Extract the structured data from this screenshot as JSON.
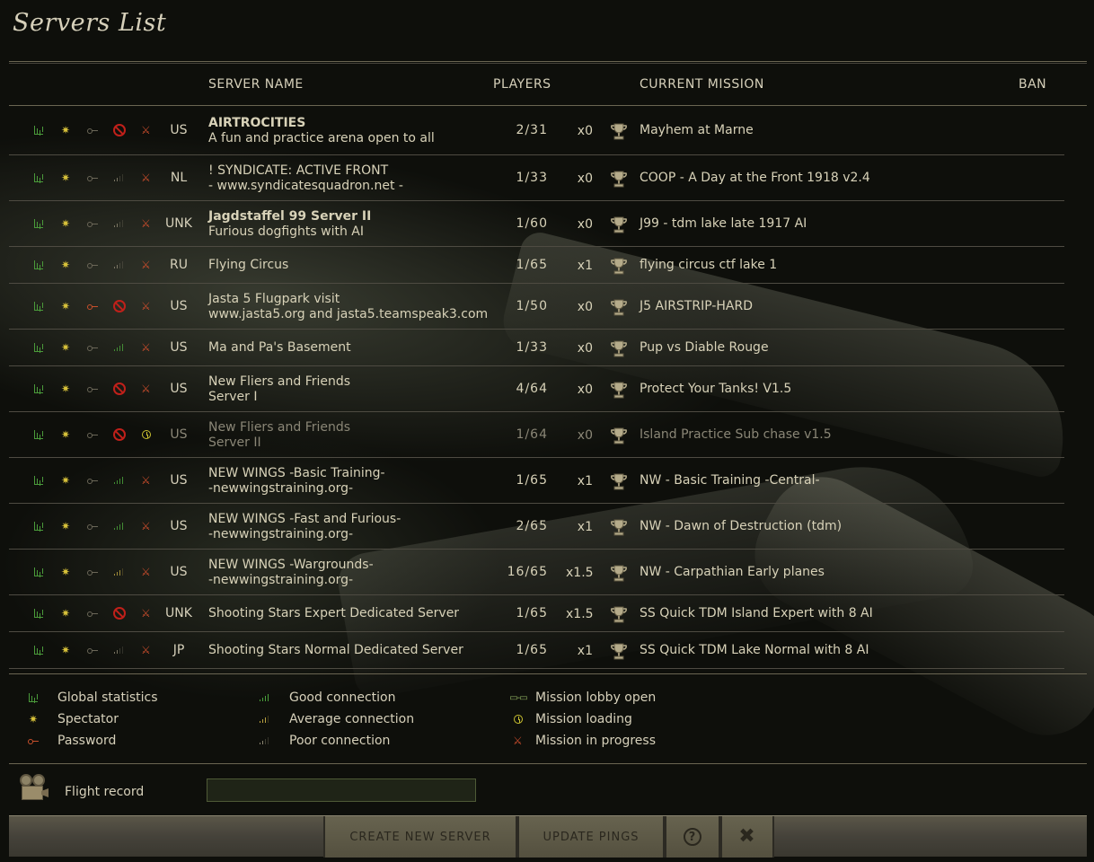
{
  "title": "Servers List",
  "columns": {
    "server_name": "SERVER NAME",
    "players": "PLAYERS",
    "current_mission": "CURRENT MISSION",
    "ban": "BAN"
  },
  "servers": [
    {
      "country": "US",
      "name_l1": "AIRTROCITIES",
      "name_l2": "A fun and practice arena open to all",
      "bold": true,
      "players": "2/31",
      "mult": "x0",
      "mission": "Mayhem at Marne",
      "password": false,
      "banned": true,
      "signal": "none",
      "status": "in-progress",
      "dim": false
    },
    {
      "country": "NL",
      "name_l1": "!        SYNDICATE: ACTIVE FRONT",
      "name_l2": "-   www.syndicatesquadron.net   -",
      "bold": false,
      "players": "1/33",
      "mult": "x0",
      "mission": "COOP - A Day at the Front 1918 v2.4",
      "password": false,
      "banned": false,
      "signal": "poor",
      "status": "in-progress",
      "dim": false
    },
    {
      "country": "UNK",
      "name_l1": "Jagdstaffel 99 Server II",
      "name_l2": "Furious dogfights with AI",
      "bold": true,
      "players": "1/60",
      "mult": "x0",
      "mission": "J99 - tdm lake late 1917 AI",
      "password": false,
      "banned": false,
      "signal": "poor",
      "status": "in-progress",
      "dim": false
    },
    {
      "country": "RU",
      "name_l1": "Flying Circus",
      "name_l2": "",
      "bold": false,
      "players": "1/65",
      "mult": "x1",
      "mission": "flying circus ctf lake 1",
      "password": false,
      "banned": false,
      "signal": "poor",
      "status": "in-progress",
      "dim": false
    },
    {
      "country": "US",
      "name_l1": "Jasta 5 Flugpark                 visit",
      "name_l2": "www.jasta5.org and jasta5.teamspeak3.com",
      "bold": false,
      "players": "1/50",
      "mult": "x0",
      "mission": "J5 AIRSTRIP-HARD",
      "password": true,
      "banned": true,
      "signal": "none",
      "status": "in-progress",
      "dim": false
    },
    {
      "country": "US",
      "name_l1": "Ma and Pa's Basement",
      "name_l2": "",
      "bold": false,
      "players": "1/33",
      "mult": "x0",
      "mission": "Pup vs Diable Rouge",
      "password": false,
      "banned": false,
      "signal": "good",
      "status": "in-progress",
      "dim": false
    },
    {
      "country": "US",
      "name_l1": "New Fliers and Friends",
      "name_l2": "Server I",
      "bold": false,
      "players": "4/64",
      "mult": "x0",
      "mission": "Protect Your Tanks! V1.5",
      "password": false,
      "banned": true,
      "signal": "none",
      "status": "in-progress",
      "dim": false
    },
    {
      "country": "US",
      "name_l1": "New Fliers and Friends",
      "name_l2": "Server II",
      "bold": false,
      "players": "1/64",
      "mult": "x0",
      "mission": "Island Practice Sub chase v1.5",
      "password": false,
      "banned": true,
      "signal": "none",
      "status": "loading",
      "dim": true
    },
    {
      "country": "US",
      "name_l1": "NEW WINGS -Basic Training-",
      "name_l2": "-newwingstraining.org-",
      "bold": false,
      "players": "1/65",
      "mult": "x1",
      "mission": "NW - Basic Training -Central-",
      "password": false,
      "banned": false,
      "signal": "good",
      "status": "in-progress",
      "dim": false
    },
    {
      "country": "US",
      "name_l1": "NEW WINGS -Fast and Furious-",
      "name_l2": "-newwingstraining.org-",
      "bold": false,
      "players": "2/65",
      "mult": "x1",
      "mission": "NW - Dawn of Destruction (tdm)",
      "password": false,
      "banned": false,
      "signal": "good",
      "status": "in-progress",
      "dim": false
    },
    {
      "country": "US",
      "name_l1": "NEW WINGS -Wargrounds-",
      "name_l2": "-newwingstraining.org-",
      "bold": false,
      "players": "16/65",
      "mult": "x1.5",
      "mission": "NW - Carpathian Early planes",
      "password": false,
      "banned": false,
      "signal": "average",
      "status": "in-progress",
      "dim": false
    },
    {
      "country": "UNK",
      "name_l1": "Shooting Stars Expert Dedicated Server",
      "name_l2": "",
      "bold": false,
      "players": "1/65",
      "mult": "x1.5",
      "mission": "SS Quick TDM Island Expert with 8 AI",
      "password": false,
      "banned": true,
      "signal": "none",
      "status": "in-progress",
      "dim": false
    },
    {
      "country": "JP",
      "name_l1": "Shooting Stars Normal Dedicated Server",
      "name_l2": "",
      "bold": false,
      "players": "1/65",
      "mult": "x1",
      "mission": "SS Quick TDM Lake Normal with 8 AI",
      "password": false,
      "banned": false,
      "signal": "poor",
      "status": "in-progress",
      "dim": false
    }
  ],
  "legend": {
    "global_stats": "Global statistics",
    "spectator": "Spectator",
    "password": "Password",
    "good": "Good connection",
    "average": "Average connection",
    "poor": "Poor connection",
    "lobby": "Mission lobby open",
    "loading": "Mission loading",
    "in_progress": "Mission in progress"
  },
  "flight_record": {
    "label": "Flight record",
    "value": ""
  },
  "footer": {
    "create": "CREATE NEW SERVER",
    "update": "UPDATE PINGS",
    "help": "?",
    "close": "✖"
  },
  "colors": {
    "accent_green": "#4a9a3a",
    "spectator_yellow": "#d8c23a",
    "ban_red": "#c0201a",
    "progress_orange": "#c84c2c"
  }
}
